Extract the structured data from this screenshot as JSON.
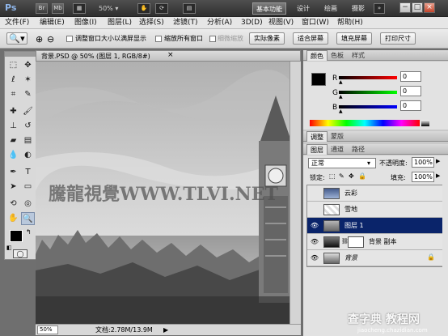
{
  "app": {
    "logo": "Ps",
    "buttons": [
      "Br",
      "Mb"
    ],
    "zoom": "50%",
    "workspaces": [
      "基本功能",
      "设计",
      "绘画",
      "摄影"
    ],
    "window_controls": [
      "−",
      "□",
      "×"
    ]
  },
  "menu": [
    "文件(F)",
    "编辑(E)",
    "图像(I)",
    "图层(L)",
    "选择(S)",
    "滤镜(T)",
    "分析(A)",
    "3D(D)",
    "视图(V)",
    "窗口(W)",
    "帮助(H)"
  ],
  "options": {
    "chk1": "调整窗口大小以满屏显示",
    "chk2": "缩放所有窗口",
    "chk3": "细微缩放",
    "buttons": [
      "实际像素",
      "适合屏幕",
      "填充屏幕",
      "打印尺寸"
    ]
  },
  "document": {
    "tab": "背景.PSD @ 50% (图层 1, RGB/8#)",
    "watermark": "騰龍視覺WWW.TLVI.NET",
    "status_zoom": "50%",
    "status_doc": "文档:2.78M/13.9M"
  },
  "color_panel": {
    "tabs": [
      "颜色",
      "色板",
      "样式"
    ],
    "r_label": "R",
    "g_label": "G",
    "b_label": "B",
    "r": "0",
    "g": "0",
    "b": "0"
  },
  "adjust_panel": {
    "tabs": [
      "调整",
      "蒙版"
    ]
  },
  "layers_panel": {
    "tabs": [
      "图层",
      "通道",
      "路径"
    ],
    "blend_mode": "正常",
    "opacity_label": "不透明度:",
    "opacity": "100%",
    "lock_label": "锁定:",
    "fill_label": "填充:",
    "fill": "100%",
    "layers": [
      {
        "name": "云彩",
        "eye": ""
      },
      {
        "name": "雪地",
        "eye": ""
      },
      {
        "name": "图层 1",
        "eye": "👁"
      },
      {
        "name": "背景 副本",
        "eye": "👁"
      },
      {
        "name": "背景",
        "eye": "👁"
      }
    ]
  },
  "footer_watermark": "查字典 教程网",
  "footer_url": "jiaocheng.chazidian.com",
  "colors": {
    "accent": "#0a246a",
    "appbar": "#3d3d3d",
    "panel": "#c9c9c9"
  }
}
